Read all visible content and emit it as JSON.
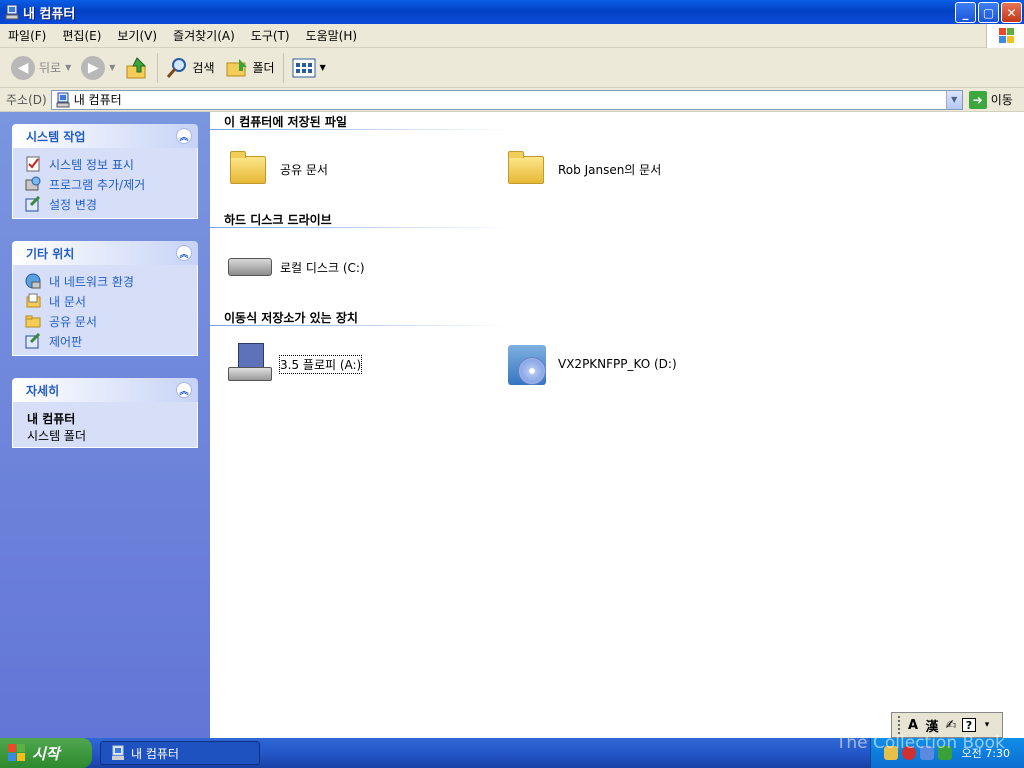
{
  "window": {
    "title": "내 컴퓨터"
  },
  "menubar": {
    "items": [
      "파일(F)",
      "편집(E)",
      "보기(V)",
      "즐겨찾기(A)",
      "도구(T)",
      "도움말(H)"
    ]
  },
  "toolbar": {
    "back": "뒤로",
    "search": "검색",
    "folders": "폴더"
  },
  "address": {
    "label": "주소(D)",
    "value": "내 컴퓨터",
    "go": "이동"
  },
  "sidebar": {
    "system_tasks": {
      "title": "시스템 작업",
      "items": [
        "시스템 정보 표시",
        "프로그램 추가/제거",
        "설정 변경"
      ]
    },
    "other_places": {
      "title": "기타 위치",
      "items": [
        "내 네트워크 환경",
        "내 문서",
        "공유 문서",
        "제어판"
      ]
    },
    "details": {
      "title": "자세히",
      "name": "내 컴퓨터",
      "type": "시스템 폴더"
    }
  },
  "content": {
    "sections": [
      {
        "title": "이 컴퓨터에 저장된 파일",
        "items": [
          "공유 문서",
          "Rob Jansen의 문서"
        ]
      },
      {
        "title": "하드 디스크 드라이브",
        "items": [
          "로컬 디스크 (C:)"
        ]
      },
      {
        "title": "이동식 저장소가 있는 장치",
        "items": [
          "3.5 플로피 (A:)",
          "VX2PKNFPP_KO (D:)"
        ]
      }
    ]
  },
  "taskbar": {
    "start": "시작",
    "window_item": "내 컴퓨터",
    "clock": "오전 7:30"
  },
  "ime": {
    "a": "A",
    "han": "漢",
    "help": "?"
  },
  "watermark": "The Collection Book"
}
